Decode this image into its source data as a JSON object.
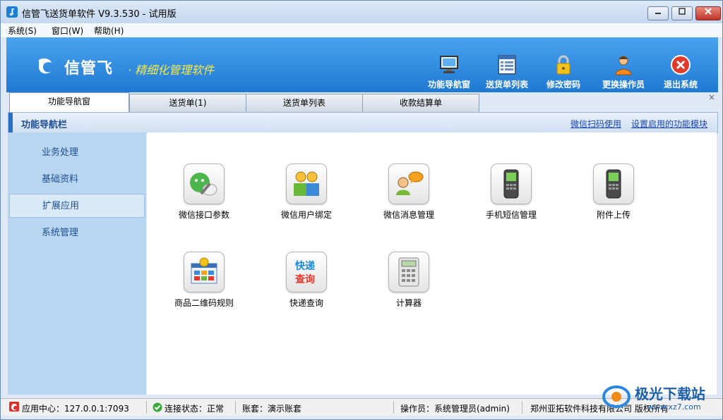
{
  "window": {
    "title": "信管飞送货单软件 V9.3.530 - 试用版",
    "app_icon_glyph": "ʆ"
  },
  "menu": [
    {
      "label": "系统(S)"
    },
    {
      "label": "窗口(W)"
    },
    {
      "label": "帮助(H)"
    }
  ],
  "banner": {
    "logo_text": "信管飞",
    "slogan": "· 精细化管理软件"
  },
  "toolbar": [
    {
      "label": "功能导航窗",
      "icon": "monitor-icon"
    },
    {
      "label": "送货单列表",
      "icon": "list-icon"
    },
    {
      "label": "修改密码",
      "icon": "lock-icon"
    },
    {
      "label": "更换操作员",
      "icon": "user-icon"
    },
    {
      "label": "退出系统",
      "icon": "exit-icon"
    }
  ],
  "tabs": [
    {
      "label": "功能导航窗",
      "active": true
    },
    {
      "label": "送货单(1)"
    },
    {
      "label": "送货单列表"
    },
    {
      "label": "收款结算单"
    }
  ],
  "tab_close_glyph": "×",
  "nav_header": {
    "title": "功能导航栏",
    "link1": "微信扫码使用",
    "link2": "设置启用的功能模块"
  },
  "sidebar": [
    {
      "label": "业务处理"
    },
    {
      "label": "基础资料"
    },
    {
      "label": "扩展应用",
      "selected": true
    },
    {
      "label": "系统管理"
    }
  ],
  "functions": [
    {
      "label": "微信接口参数",
      "icon": "wechat-config-icon"
    },
    {
      "label": "微信用户绑定",
      "icon": "user-bind-icon"
    },
    {
      "label": "微信消息管理",
      "icon": "message-icon"
    },
    {
      "label": "手机短信管理",
      "icon": "mobile-phone-icon"
    },
    {
      "label": "附件上传",
      "icon": "mobile-phone-icon"
    },
    {
      "label": "商品二维码规则",
      "icon": "qrcode-rule-icon"
    },
    {
      "label": "快递查询",
      "icon": "express-query-icon",
      "icon_text1": "快递",
      "icon_text2": "查询"
    },
    {
      "label": "计算器",
      "icon": "calculator-icon"
    }
  ],
  "status": {
    "app_center": "应用中心：127.0.0.1:7093",
    "connection": "连接状态：正常",
    "account": "账套：演示账套",
    "operator": "操作员：系统管理员(admin)",
    "company": "郑州亚拓软件科技有限公司 版权所有"
  },
  "watermark": {
    "text": "极光下载站",
    "url": "www.xz7.com"
  },
  "colors": {
    "banner": "#2a86de",
    "sidebar": "#b9d6f1",
    "accent": "#1e4f8f"
  }
}
